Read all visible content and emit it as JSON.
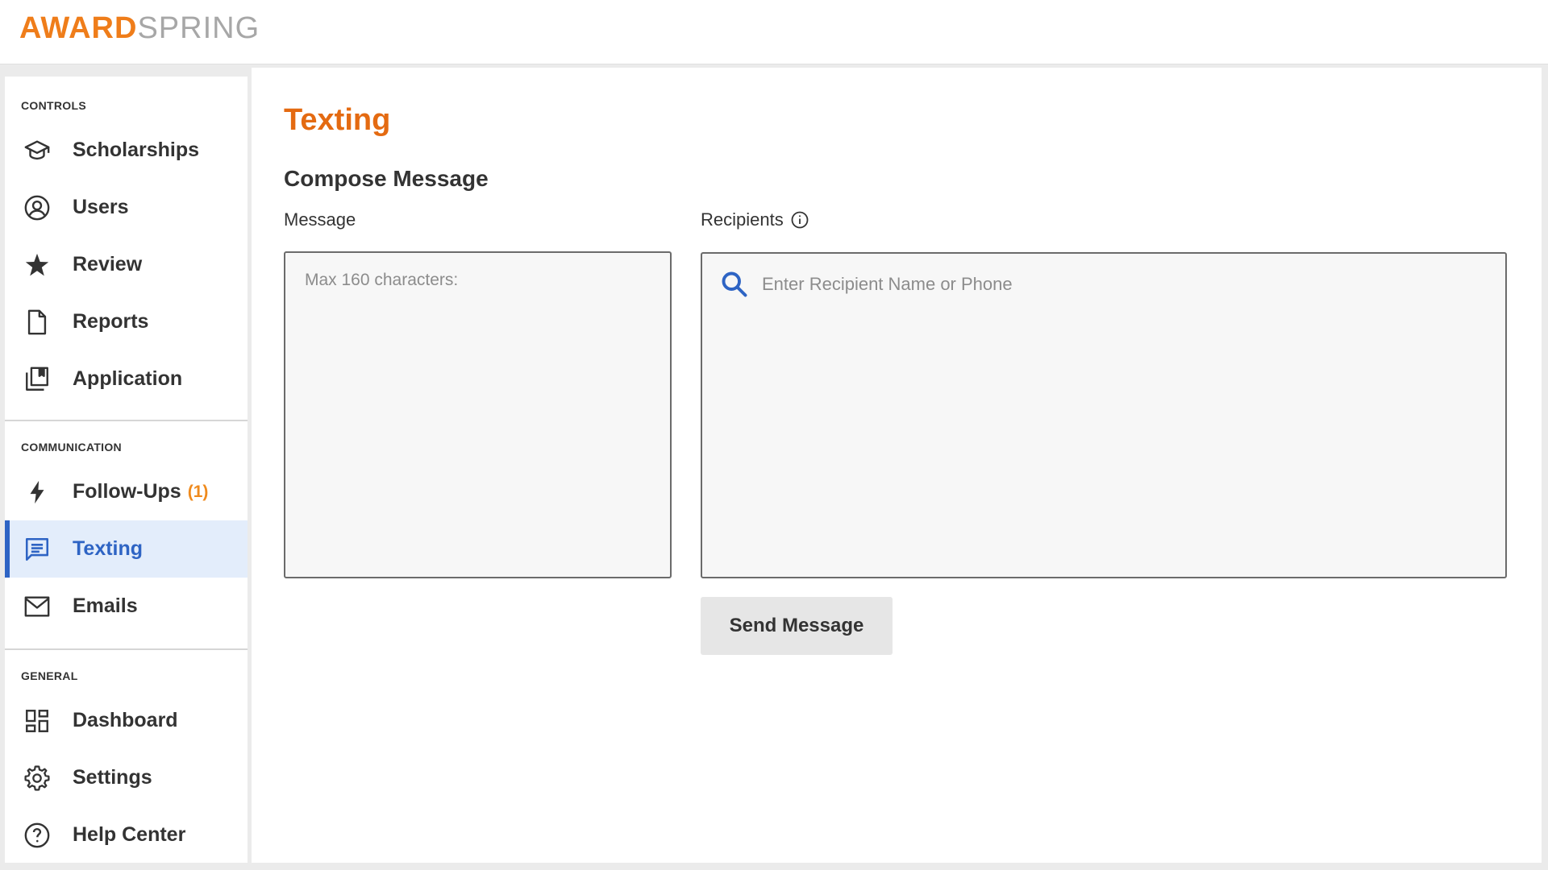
{
  "brand": {
    "part1": "AWARD",
    "part2": "SPRING"
  },
  "sidebar": {
    "sections": [
      {
        "label": "CONTROLS"
      },
      {
        "label": "COMMUNICATION"
      },
      {
        "label": "GENERAL"
      }
    ],
    "items": [
      {
        "label": "Scholarships",
        "icon": "graduation-cap-icon"
      },
      {
        "label": "Users",
        "icon": "user-circle-icon"
      },
      {
        "label": "Review",
        "icon": "star-icon"
      },
      {
        "label": "Reports",
        "icon": "document-icon"
      },
      {
        "label": "Application",
        "icon": "application-icon"
      },
      {
        "label": "Follow-Ups",
        "badge": "(1)",
        "icon": "lightning-icon"
      },
      {
        "label": "Texting",
        "icon": "message-icon",
        "active": true
      },
      {
        "label": "Emails",
        "icon": "envelope-icon"
      },
      {
        "label": "Dashboard",
        "icon": "dashboard-icon"
      },
      {
        "label": "Settings",
        "icon": "gear-icon"
      },
      {
        "label": "Help Center",
        "icon": "help-icon"
      }
    ]
  },
  "main": {
    "title": "Texting",
    "subtitle": "Compose Message",
    "message": {
      "label": "Message",
      "placeholder": "Max 160 characters:",
      "value": ""
    },
    "recipients": {
      "label": "Recipients",
      "placeholder": "Enter Recipient Name or Phone",
      "value": ""
    },
    "send_label": "Send Message"
  },
  "colors": {
    "brand_orange": "#ef7d1a",
    "title_orange": "#e46a11",
    "active_blue": "#2e64c4",
    "active_bg": "#e3edfb",
    "search_icon_blue": "#2e64c4"
  }
}
